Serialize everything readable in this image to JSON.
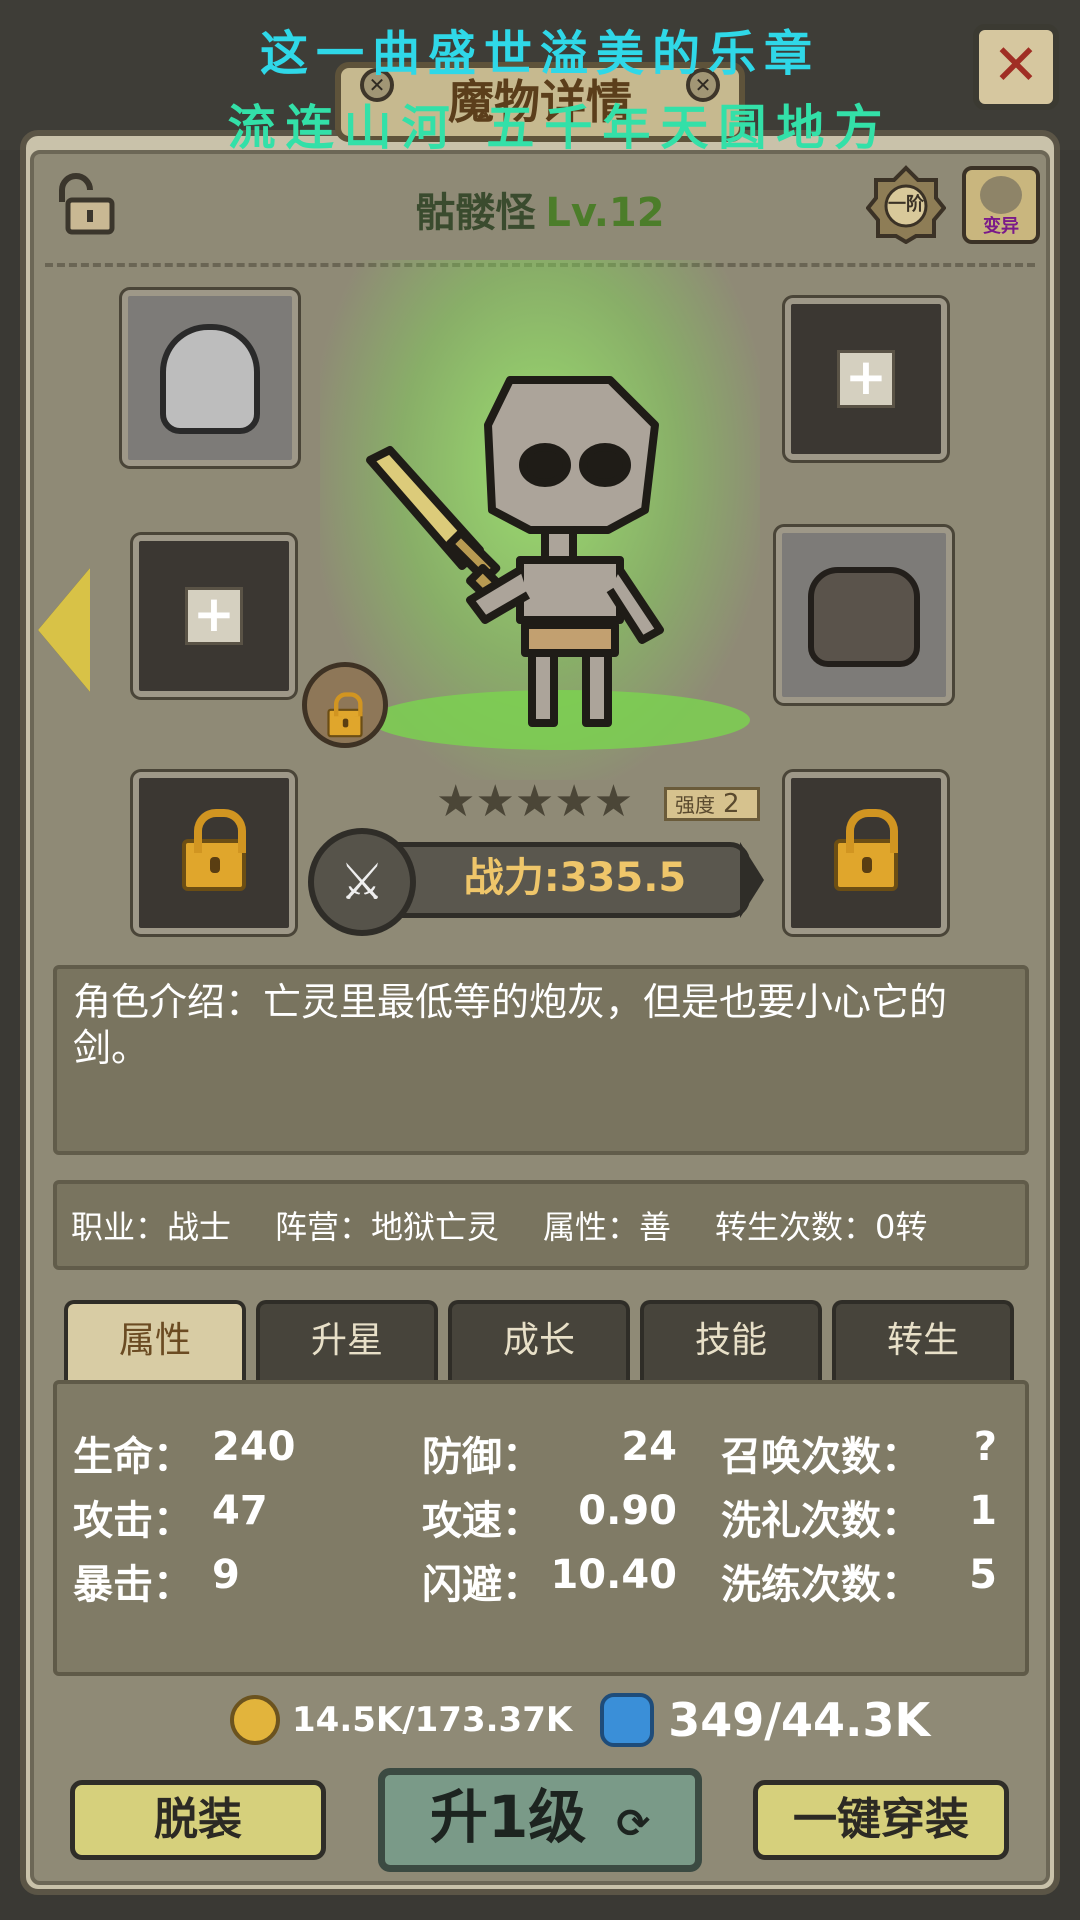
{
  "overlay": {
    "line1": "这一曲盛世溢美的乐章",
    "line2": "流连山河 五千年天圆地方"
  },
  "window": {
    "title": "魔物详情",
    "close_label": "✕"
  },
  "monster": {
    "name": "骷髅怪",
    "level": "Lv.12",
    "tier_badge": "一阶",
    "mutate_label": "变异",
    "stars": "★★★★★",
    "strength_label": "强度",
    "strength_value": "2",
    "power": "战力:335.5",
    "description": "角色介绍：亡灵里最低等的炮灰，但是也要小心它的剑。"
  },
  "info": {
    "job": "职业：战士",
    "camp": "阵营：地狱亡灵",
    "attribute": "属性：善",
    "rebirth": "转生次数：0转"
  },
  "tabs": [
    "属性",
    "升星",
    "成长",
    "技能",
    "转生"
  ],
  "stats": {
    "hp_label": "生命：",
    "hp": "240",
    "atk_label": "攻击：",
    "atk": "47",
    "crit_label": "暴击：",
    "crit": "9",
    "def_label": "防御：",
    "def": "24",
    "spd_label": "攻速：",
    "spd": "0.90",
    "dodge_label": "闪避：",
    "dodge": "10.40",
    "summon_label": "召唤次数：",
    "summon": "?",
    "baptism_label": "洗礼次数：",
    "baptism": "1",
    "refine_label": "洗练次数：",
    "refine": "5"
  },
  "resources": {
    "gold": "14.5K/173.37K",
    "gem": "349/44.3K"
  },
  "buttons": {
    "unequip": "脱装",
    "level_up": "升1级",
    "equip_all": "一键穿装"
  },
  "colors": {
    "accent_green": "#7bd44f",
    "overlay_cyan": "#2fd8e8",
    "power_gold": "#efc66a"
  }
}
